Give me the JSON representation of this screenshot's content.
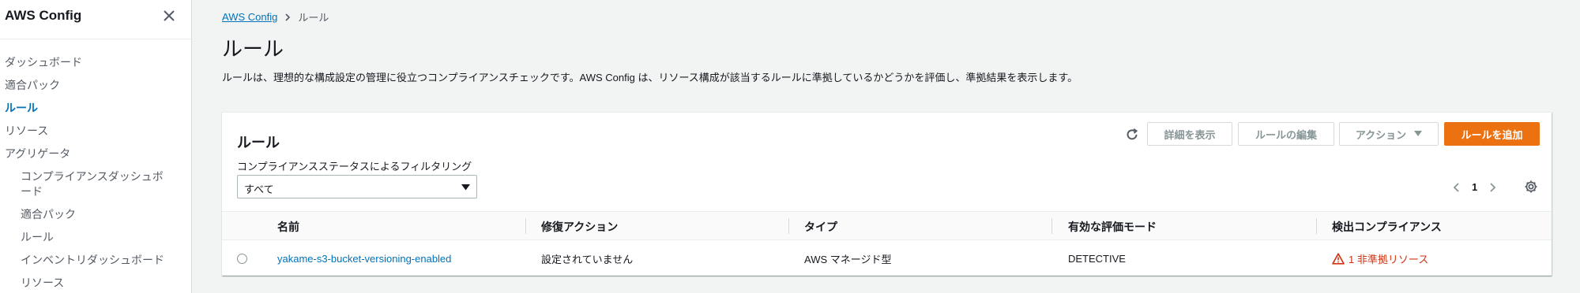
{
  "sidebar": {
    "title": "AWS Config",
    "items": [
      {
        "label": "ダッシュボード",
        "level": 0,
        "active": false
      },
      {
        "label": "適合パック",
        "level": 0,
        "active": false
      },
      {
        "label": "ルール",
        "level": 0,
        "active": true
      },
      {
        "label": "リソース",
        "level": 0,
        "active": false
      },
      {
        "label": "アグリゲータ",
        "level": 0,
        "active": false
      },
      {
        "label": "コンプライアンスダッシュボード",
        "level": 1,
        "active": false
      },
      {
        "label": "適合パック",
        "level": 1,
        "active": false
      },
      {
        "label": "ルール",
        "level": 1,
        "active": false
      },
      {
        "label": "インベントリダッシュボード",
        "level": 1,
        "active": false
      },
      {
        "label": "リソース",
        "level": 1,
        "active": false
      }
    ]
  },
  "breadcrumb": {
    "root": "AWS Config",
    "current": "ルール"
  },
  "page": {
    "title": "ルール",
    "description": "ルールは、理想的な構成設定の管理に役立つコンプライアンスチェックです。AWS Config は、リソース構成が該当するルールに準拠しているかどうかを評価し、準拠結果を表示します。"
  },
  "panel": {
    "title": "ルール",
    "buttons": {
      "details": "詳細を表示",
      "edit": "ルールの編集",
      "actions": "アクション",
      "add": "ルールを追加"
    },
    "filter": {
      "label": "コンプライアンスステータスによるフィルタリング",
      "value": "すべて"
    },
    "pagination": {
      "current_page": "1"
    }
  },
  "table": {
    "columns": [
      "名前",
      "修復アクション",
      "タイプ",
      "有効な評価モード",
      "検出コンプライアンス"
    ],
    "rows": [
      {
        "name": "yakame-s3-bucket-versioning-enabled",
        "remediation": "設定されていません",
        "type": "AWS マネージド型",
        "mode": "DETECTIVE",
        "compliance": "1 非準拠リソース"
      }
    ]
  },
  "colors": {
    "accent": "#0073bb",
    "primary_button": "#ec7211",
    "noncompliant": "#d13212",
    "background": "#f2f3f3"
  }
}
